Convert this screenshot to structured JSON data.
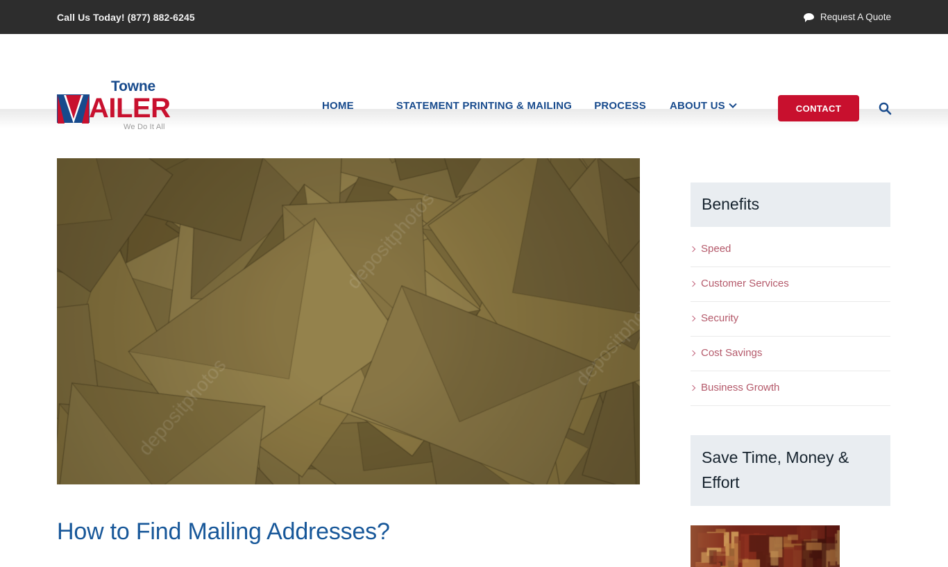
{
  "topbar": {
    "phone_text": "Call Us Today! (877) 882-6245",
    "quote_label": "Request A Quote",
    "quote_icon": "speech-bubble-icon",
    "background_color": "#2d2d2d"
  },
  "header": {
    "logo": {
      "line1": "Towne",
      "mark_letter": "M",
      "line2": "AILER",
      "tagline": "We Do It All",
      "blue": "#174a8c",
      "red": "#c8102e"
    },
    "nav": [
      {
        "label": "HOME",
        "has_dropdown": false
      },
      {
        "label": "STATEMENT PRINTING & MAILING",
        "has_dropdown": false
      },
      {
        "label": "PROCESS",
        "has_dropdown": false
      },
      {
        "label": "ABOUT US",
        "has_dropdown": true
      }
    ],
    "contact_label": "CONTACT",
    "contact_color": "#c8102e",
    "search_icon": "search-icon",
    "nav_color": "#174a8c"
  },
  "main": {
    "featured_image_alt": "pile of khaki envelopes",
    "featured_image_watermark": "depositphotos",
    "post_title": "How to Find Mailing Addresses?",
    "post_title_color": "#175799"
  },
  "sidebar": {
    "widgets": [
      {
        "title": "Benefits",
        "items": [
          {
            "label": "Speed"
          },
          {
            "label": "Customer Services"
          },
          {
            "label": "Security"
          },
          {
            "label": "Cost Savings"
          },
          {
            "label": "Business Growth"
          }
        ]
      },
      {
        "title": "Save Time, Money & Effort",
        "image_alt": "dark red interior photo"
      }
    ],
    "header_background": "#e9edf1",
    "link_color": "#b4596a"
  }
}
